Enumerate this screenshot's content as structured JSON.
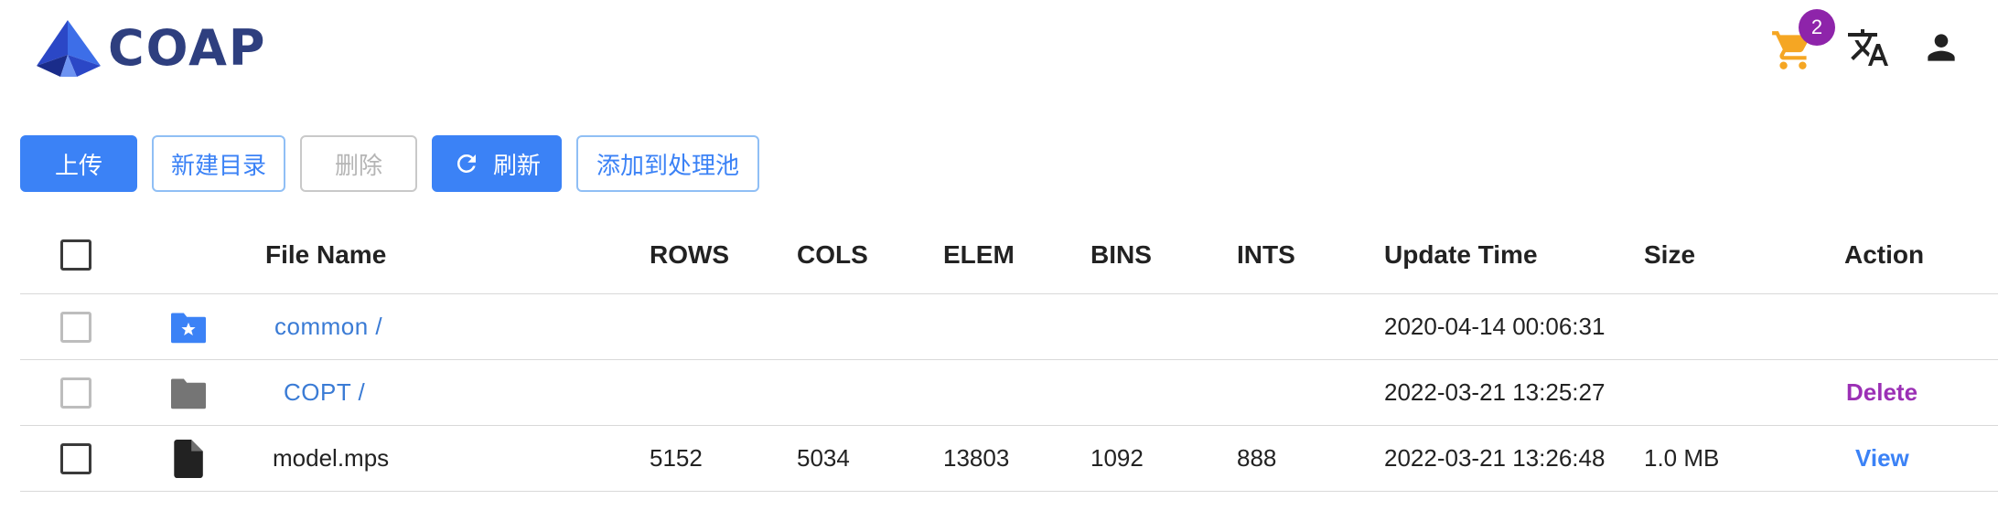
{
  "brand": {
    "name": "COAP"
  },
  "header": {
    "cart_count": "2"
  },
  "toolbar": {
    "upload_label": "上传",
    "new_dir_label": "新建目录",
    "delete_label": "删除",
    "refresh_label": "刷新",
    "add_pool_label": "添加到处理池"
  },
  "table": {
    "columns": [
      "File Name",
      "ROWS",
      "COLS",
      "ELEM",
      "BINS",
      "INTS",
      "Update Time",
      "Size",
      "Action"
    ],
    "rows": [
      {
        "icon": "folder-star-icon",
        "name": "common /",
        "rows": "",
        "cols": "",
        "elem": "",
        "bins": "",
        "ints": "",
        "update_time": "2020-04-14 00:06:31",
        "size": "",
        "action": ""
      },
      {
        "icon": "folder-icon",
        "name": "COPT /",
        "rows": "",
        "cols": "",
        "elem": "",
        "bins": "",
        "ints": "",
        "update_time": "2022-03-21 13:25:27",
        "size": "",
        "action": "Delete"
      },
      {
        "icon": "file-icon",
        "name": "model.mps",
        "rows": "5152",
        "cols": "5034",
        "elem": "13803",
        "bins": "1092",
        "ints": "888",
        "update_time": "2022-03-21 13:26:48",
        "size": "1.0 MB",
        "action": "View"
      }
    ]
  },
  "colors": {
    "primary": "#3b82f6",
    "link": "#3a7bd5",
    "badge": "#8e24aa",
    "cart": "#f5a623",
    "delete": "#9b30b5"
  }
}
